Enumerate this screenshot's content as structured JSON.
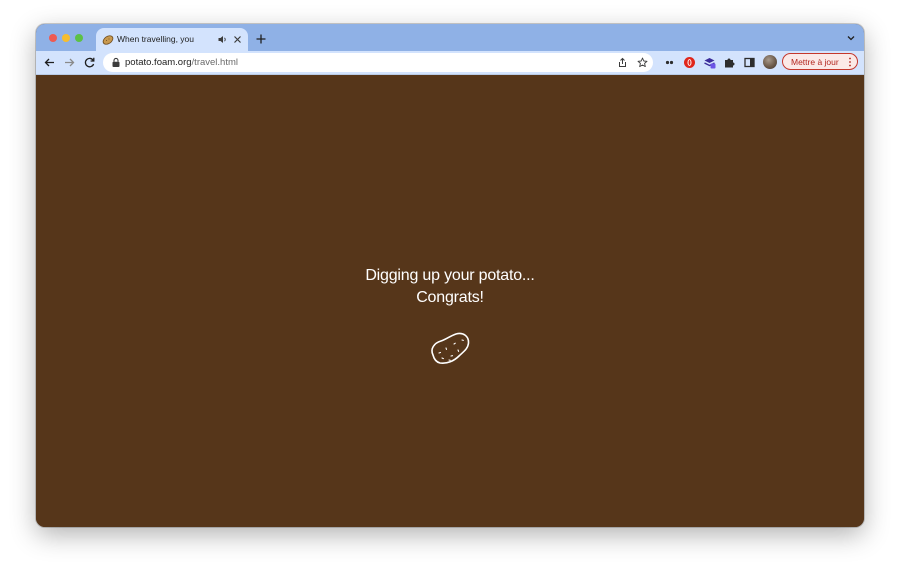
{
  "browser": {
    "tab": {
      "title": "When travelling, you",
      "favicon": "potato-icon"
    },
    "address_bar": {
      "host": "potato.foam.org",
      "path": "/travel.html"
    },
    "update_button": {
      "label": "Mettre à jour"
    },
    "colors": {
      "tabstrip": "#8fb1e6",
      "toolbar": "#d3e3fd",
      "update_accent": "#c5372c"
    }
  },
  "page": {
    "line1": "Digging up your potato...",
    "line2": "Congrats!",
    "icon": "potato-outline-icon",
    "background": "#56361a",
    "text_color": "#ffffff"
  }
}
